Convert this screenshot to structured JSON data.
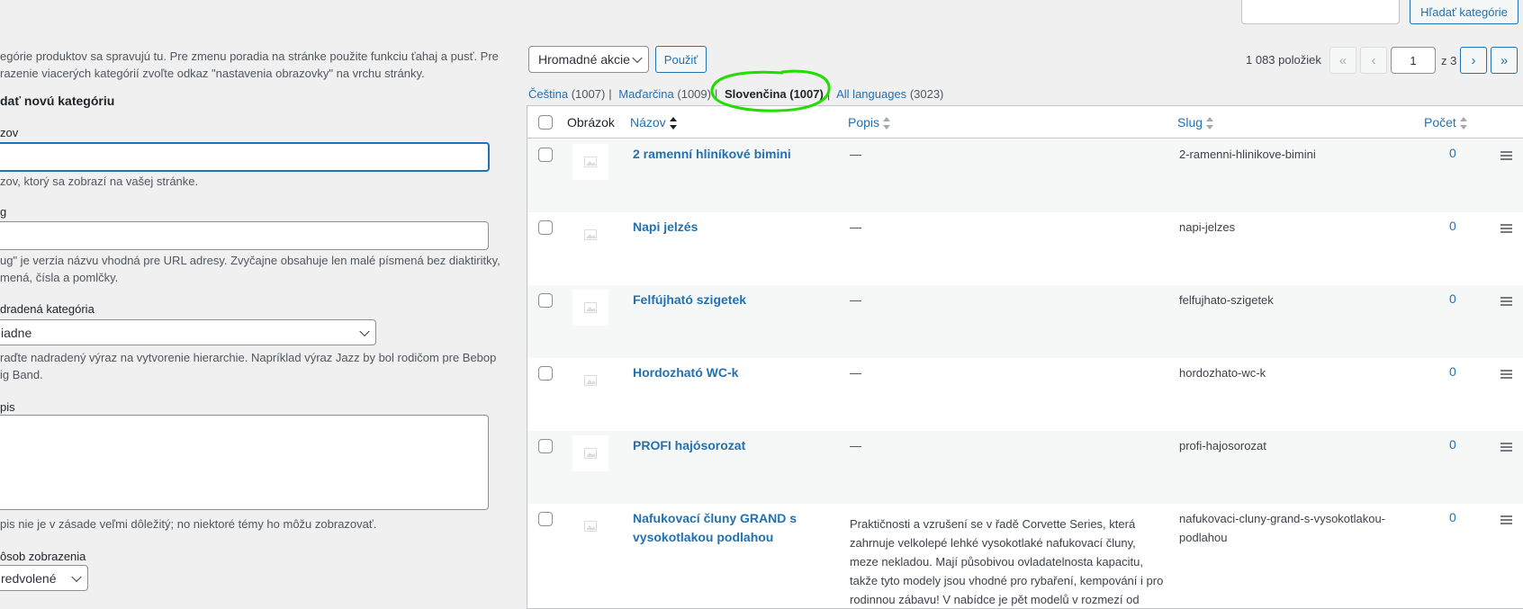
{
  "search": {
    "button_label": "Hľadať kategórie"
  },
  "form": {
    "intro_line1": "egórie produktov sa spravujú tu. Pre zmenu poradia na stránke použite funkciu ťahaj a pusť. Pre",
    "intro_line2": "razenie viacerých kategórií zvoľte odkaz \"nastavenia obrazovky\" na vrchu stránky.",
    "heading": "dať novú kategóriu",
    "name_label": "zov",
    "name_help": "zov, ktorý sa zobrazí na vašej stránke.",
    "slug_label": "g",
    "slug_help_line1": "ug\" je verzia názvu vhodná pre URL adresy. Zvyčajne obsahuje len malé písmená bez diaktiritky,",
    "slug_help_line2": "mená, čísla a pomlčky.",
    "parent_label": "dradená kategória",
    "parent_value": "iadne",
    "parent_help_line1": "raďte nadradený výraz na vytvorenie hierarchie. Napríklad výraz Jazz by bol rodičom pre Bebop",
    "parent_help_line2": "ig Band.",
    "desc_label": "pis",
    "desc_help": "pis nie je v zásade veľmi dôležitý; no niektoré témy ho môžu zobrazovať.",
    "display_label": "ôsob zobrazenia",
    "display_value": "redvolené"
  },
  "toolbar": {
    "bulk_label": "Hromadné akcie",
    "apply_label": "Použiť",
    "items_count": "1 083 položiek",
    "first": "«",
    "prev": "‹",
    "page": "1",
    "page_total": "z 3",
    "next": "›",
    "last": "»"
  },
  "languages": [
    {
      "name": "Čeština",
      "count": "(1007)"
    },
    {
      "name": "Maďarčina",
      "count": "(1009)"
    },
    {
      "name": "Slovenčina",
      "count": "(1007)"
    },
    {
      "name": "All languages",
      "count": "(3023)"
    }
  ],
  "annotation_color": "#22dd00",
  "table": {
    "headers": {
      "image": "Obrázok",
      "name": "Názov",
      "description": "Popis",
      "slug": "Slug",
      "count": "Počet"
    },
    "rows": [
      {
        "name": "2 ramenní hliníkové bimini",
        "description": "—",
        "slug": "2-ramenni-hlinikove-bimini",
        "count": "0"
      },
      {
        "name": "Napi jelzés",
        "description": "—",
        "slug": "napi-jelzes",
        "count": "0"
      },
      {
        "name": "Felfújható szigetek",
        "description": "—",
        "slug": "felfujhato-szigetek",
        "count": "0"
      },
      {
        "name": "Hordozható WC-k",
        "description": "—",
        "slug": "hordozhato-wc-k",
        "count": "0"
      },
      {
        "name": "PROFI hajósorozat",
        "description": "—",
        "slug": "profi-hajosorozat",
        "count": "0"
      },
      {
        "name": "Nafukovací čluny GRAND s vysokotlakou podlahou",
        "description": "Praktičnosti a vzrušení se v řadě Corvette Series, která zahrnuje velkolepé lehké vysokotlaké nafukovací čluny, meze nekladou. Mají působivou ovladatelnosta kapacitu, takže tyto modely jsou vhodné pro rybaření, kempování i pro rodinnou zábavu! V nabídce je pět modelů v rozmezí od",
        "slug": "nafukovaci-cluny-grand-s-vysokotlakou-podlahou",
        "count": "0"
      }
    ]
  }
}
